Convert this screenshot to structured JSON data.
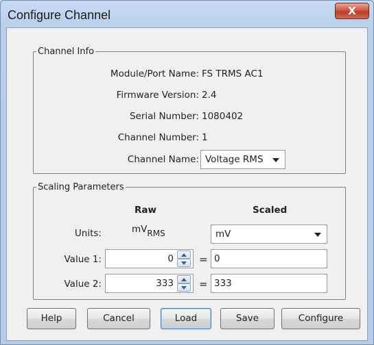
{
  "window": {
    "title": "Configure Channel",
    "close_label": "X"
  },
  "channel_info": {
    "legend": "Channel Info",
    "module_port_label": "Module/Port Name:",
    "module_port_value": "FS TRMS AC1",
    "firmware_label": "Firmware Version:",
    "firmware_value": "2.4",
    "serial_label": "Serial Number:",
    "serial_value": "1080402",
    "channel_number_label": "Channel Number:",
    "channel_number_value": "1",
    "channel_name_label": "Channel Name:",
    "channel_name_value": "Voltage RMS"
  },
  "scaling": {
    "legend": "Scaling Parameters",
    "raw_header": "Raw",
    "scaled_header": "Scaled",
    "units_label": "Units:",
    "raw_units_main": "mV",
    "raw_units_sub": "RMS",
    "scaled_units_value": "mV",
    "value1_label": "Value 1:",
    "value1_raw": "0",
    "value1_scaled": "0",
    "value2_label": "Value 2:",
    "value2_raw": "333",
    "value2_scaled": "333",
    "equals": "="
  },
  "buttons": {
    "help": "Help",
    "cancel": "Cancel",
    "load": "Load",
    "save": "Save",
    "configure": "Configure"
  }
}
